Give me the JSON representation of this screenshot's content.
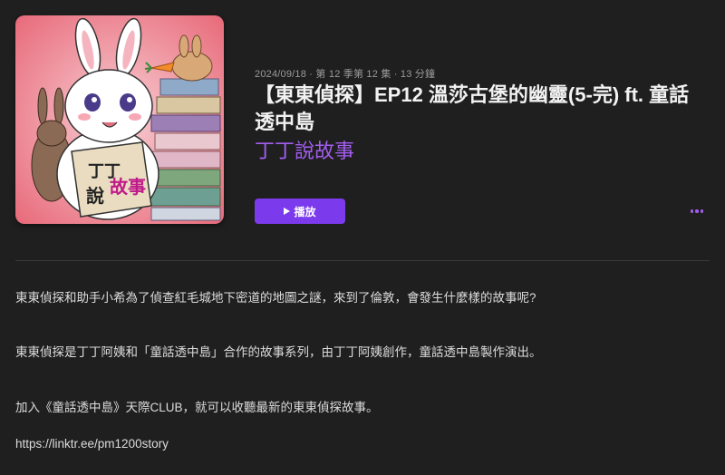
{
  "episode": {
    "meta": "2024/09/18 · 第 12 季第 12 集 · 13 分鐘",
    "title": "【東東偵探】EP12 溫莎古堡的幽靈(5-完) ft. 童話透中島",
    "show_name": "丁丁說故事"
  },
  "actions": {
    "play_label": "播放",
    "more_icon": "more-horizontal-icon"
  },
  "artwork": {
    "book_text_1": "丁丁",
    "book_text_2": "說",
    "book_text_3": "故事"
  },
  "description": {
    "paragraph_1": "東東偵探和助手小希為了偵查紅毛城地下密道的地圖之謎，來到了倫敦，會發生什麼樣的故事呢?",
    "paragraph_2": "東東偵探是丁丁阿姨和「童話透中島」合作的故事系列，由丁丁阿姨創作，童話透中島製作演出。",
    "paragraph_3": "加入《童話透中島》天際CLUB，就可以收聽最新的東東偵探故事。",
    "link": "https://linktr.ee/pm1200story"
  },
  "colors": {
    "accent": "#7c3aed",
    "accent_text": "#a35df0",
    "background": "#1f1f1f"
  }
}
